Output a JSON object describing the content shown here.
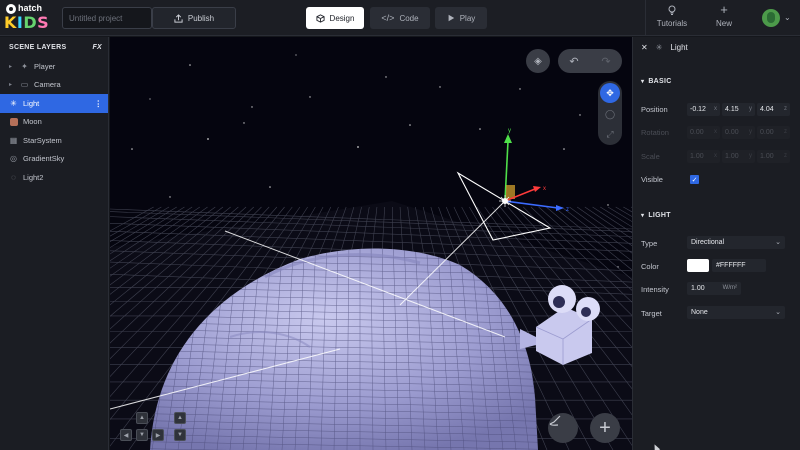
{
  "app": {
    "logo_top": "hatch",
    "logo_kids": [
      "K",
      "I",
      "D",
      "S"
    ]
  },
  "toolbar": {
    "project_placeholder": "Untitled project",
    "publish_label": "Publish",
    "modes": [
      {
        "label": "Design",
        "icon": "cube-icon",
        "active": true
      },
      {
        "label": "Code",
        "icon": "code-icon",
        "active": false
      },
      {
        "label": "Play",
        "icon": "play-icon",
        "active": false
      }
    ],
    "tutorials_label": "Tutorials",
    "new_label": "New"
  },
  "scene_layers": {
    "title": "SCENE LAYERS",
    "fx_label": "FX",
    "items": [
      {
        "label": "Player",
        "icon": "player-icon",
        "expandable": true
      },
      {
        "label": "Camera",
        "icon": "camera-icon",
        "expandable": true
      },
      {
        "label": "Light",
        "icon": "light-icon",
        "selected": true
      },
      {
        "label": "Moon",
        "icon": "moon-icon"
      },
      {
        "label": "StarSystem",
        "icon": "starsystem-icon"
      },
      {
        "label": "GradientSky",
        "icon": "gradientsky-icon"
      },
      {
        "label": "Light2",
        "icon": "light-icon"
      }
    ]
  },
  "viewport": {
    "gizmo_axes": [
      "y",
      "x",
      "z"
    ]
  },
  "inspector": {
    "object_name": "Light",
    "basic": {
      "title": "BASIC",
      "position_label": "Position",
      "position": {
        "x": "-0.12",
        "y": "4.15",
        "z": "4.04"
      },
      "rotation_label": "Rotation",
      "rotation": {
        "x": "0.00",
        "y": "0.00",
        "z": "0.00"
      },
      "scale_label": "Scale",
      "scale": {
        "x": "1.00",
        "y": "1.00",
        "z": "1.00"
      },
      "visible_label": "Visible",
      "visible": true
    },
    "light": {
      "title": "LIGHT",
      "type_label": "Type",
      "type_value": "Directional",
      "color_label": "Color",
      "color_value": "#FFFFFF",
      "intensity_label": "Intensity",
      "intensity_value": "1.00",
      "intensity_unit": "W/m²",
      "target_label": "Target",
      "target_value": "None"
    }
  },
  "colors": {
    "accent": "#2f68e3",
    "moon": "#a9a9d8",
    "grid": "#3f4150"
  }
}
